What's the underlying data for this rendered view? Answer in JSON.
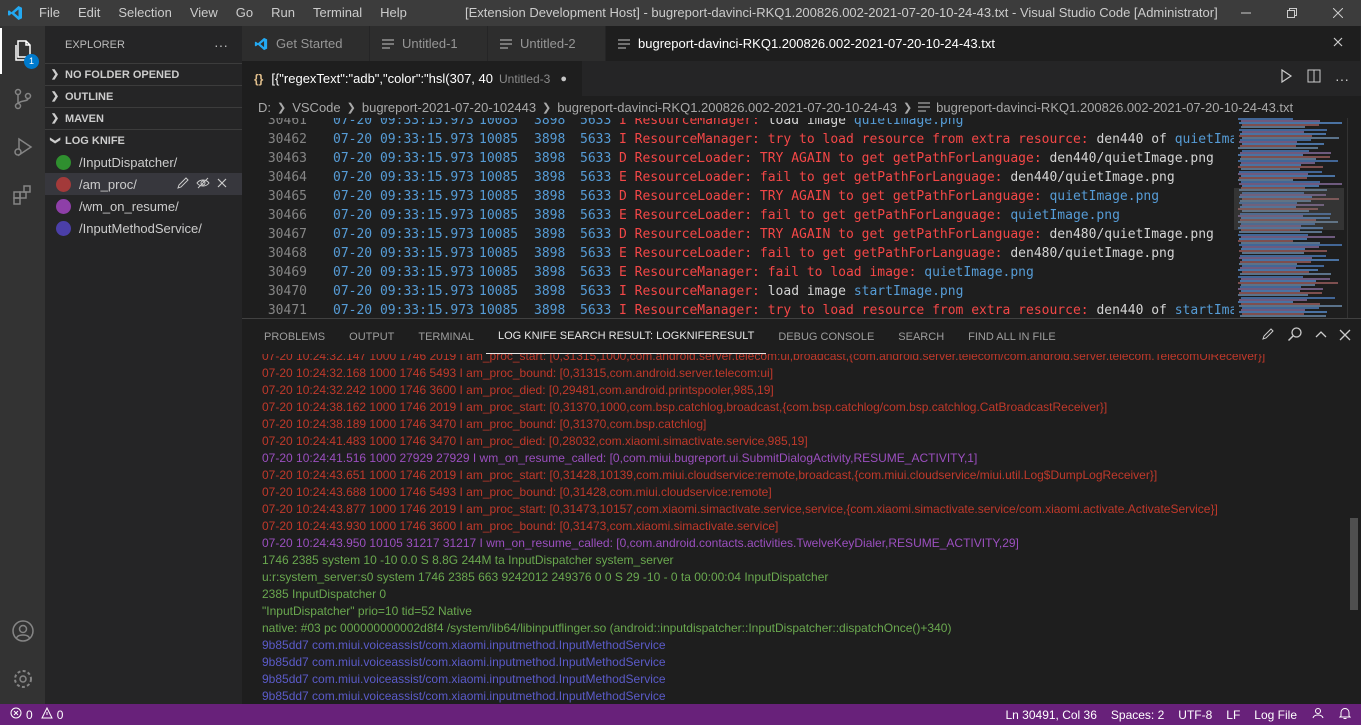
{
  "titlebar": {
    "menus": [
      "File",
      "Edit",
      "Selection",
      "View",
      "Go",
      "Run",
      "Terminal",
      "Help"
    ],
    "window_title": "[Extension Development Host] - bugreport-davinci-RKQ1.200826.002-2021-07-20-10-24-43.txt - Visual Studio Code [Administrator]"
  },
  "activitybar": {
    "explorer_badge": "1"
  },
  "sidebar": {
    "title": "EXPLORER",
    "more": "···",
    "sections": [
      "NO FOLDER OPENED",
      "OUTLINE",
      "MAVEN",
      "LOG KNIFE"
    ],
    "log_knife_items": [
      {
        "label": "/InputDispatcher/",
        "color": "#2f8f2f"
      },
      {
        "label": "/am_proc/",
        "color": "#a33a3a"
      },
      {
        "label": "/wm_on_resume/",
        "color": "#8e3fa8"
      },
      {
        "label": "/InputMethodService/",
        "color": "#4b3fa8"
      }
    ]
  },
  "tabs": [
    {
      "label": "Get Started",
      "icon": "vscode-icon"
    },
    {
      "label": "Untitled-1",
      "icon": "lines-icon"
    },
    {
      "label": "Untitled-2",
      "icon": "lines-icon"
    },
    {
      "label": "bugreport-davinci-RKQ1.200826.002-2021-07-20-10-24-43.txt",
      "icon": "lines-icon"
    }
  ],
  "tab2": {
    "icon": "{}",
    "label": "[{\"regexText\":\"adb\",\"color\":\"hsl(307, 40",
    "desc": "Untitled-3",
    "modified": "●"
  },
  "breadcrumb": [
    "D:",
    "VSCode",
    "bugreport-2021-07-20-102443",
    "bugreport-davinci-RKQ1.200826.002-2021-07-20-10-24-43",
    "bugreport-davinci-RKQ1.200826.002-2021-07-20-10-24-43.txt"
  ],
  "editor": {
    "lines": [
      {
        "num": "30461",
        "date": "07-20 09:33:15.973",
        "p1": "10085",
        "p2": "3898",
        "p3": "5633",
        "lvl": "I",
        "red": "ResourceManager:",
        "wht": "load image",
        "blu": "quietImage.png",
        "tail": ""
      },
      {
        "num": "30462",
        "date": "07-20 09:33:15.973",
        "p1": "10085",
        "p2": "3898",
        "p3": "5633",
        "lvl": "I",
        "red": "ResourceManager: try to load resource from extra resource:",
        "wht": "den440 of",
        "blu": "quietImag",
        "tail": ""
      },
      {
        "num": "30463",
        "date": "07-20 09:33:15.973",
        "p1": "10085",
        "p2": "3898",
        "p3": "5633",
        "lvl": "D",
        "red": "ResourceLoader: TRY AGAIN to get getPathForLanguage:",
        "wht": "den440/quietImage.png",
        "blu": "",
        "tail": ""
      },
      {
        "num": "30464",
        "date": "07-20 09:33:15.973",
        "p1": "10085",
        "p2": "3898",
        "p3": "5633",
        "lvl": "E",
        "red": "ResourceLoader: fail to get getPathForLanguage:",
        "wht": "den440/quietImage.png",
        "blu": "",
        "tail": ""
      },
      {
        "num": "30465",
        "date": "07-20 09:33:15.973",
        "p1": "10085",
        "p2": "3898",
        "p3": "5633",
        "lvl": "D",
        "red": "ResourceLoader: TRY AGAIN to get getPathForLanguage:",
        "wht": "",
        "blu": "quietImage.png",
        "tail": ""
      },
      {
        "num": "30466",
        "date": "07-20 09:33:15.973",
        "p1": "10085",
        "p2": "3898",
        "p3": "5633",
        "lvl": "E",
        "red": "ResourceLoader: fail to get getPathForLanguage:",
        "wht": "",
        "blu": "quietImage.png",
        "tail": ""
      },
      {
        "num": "30467",
        "date": "07-20 09:33:15.973",
        "p1": "10085",
        "p2": "3898",
        "p3": "5633",
        "lvl": "D",
        "red": "ResourceLoader: TRY AGAIN to get getPathForLanguage:",
        "wht": "den480/quietImage.png",
        "blu": "",
        "tail": ""
      },
      {
        "num": "30468",
        "date": "07-20 09:33:15.973",
        "p1": "10085",
        "p2": "3898",
        "p3": "5633",
        "lvl": "E",
        "red": "ResourceLoader: fail to get getPathForLanguage:",
        "wht": "den480/quietImage.png",
        "blu": "",
        "tail": ""
      },
      {
        "num": "30469",
        "date": "07-20 09:33:15.973",
        "p1": "10085",
        "p2": "3898",
        "p3": "5633",
        "lvl": "E",
        "red": "ResourceManager: fail to load image:",
        "wht": "",
        "blu": "quietImage.png",
        "tail": ""
      },
      {
        "num": "30470",
        "date": "07-20 09:33:15.973",
        "p1": "10085",
        "p2": "3898",
        "p3": "5633",
        "lvl": "I",
        "red": "ResourceManager:",
        "wht": "load image",
        "blu": "startImage.png",
        "tail": ""
      },
      {
        "num": "30471",
        "date": "07-20 09:33:15.973",
        "p1": "10085",
        "p2": "3898",
        "p3": "5633",
        "lvl": "I",
        "red": "ResourceManager: try to load resource from extra resource:",
        "wht": "den440 of",
        "blu": "startImag",
        "tail": ""
      }
    ]
  },
  "panel": {
    "tabs": [
      "PROBLEMS",
      "OUTPUT",
      "TERMINAL",
      "LOG KNIFE SEARCH RESULT: LOGKNIFERESULT",
      "DEBUG CONSOLE",
      "SEARCH",
      "FIND ALL IN FILE"
    ],
    "active_tab": 3,
    "lines": [
      {
        "text": "07-20 10:24:32.147 1000 1746 2019 I am_proc_start: [0,31315,1000,com.android.server.telecom:ui,broadcast,{com.android.server.telecom/com.android.server.telecom.TelecomUiReceiver}]",
        "color": "red"
      },
      {
        "text": "07-20 10:24:32.168 1000 1746 5493 I am_proc_bound: [0,31315,com.android.server.telecom:ui]",
        "color": "red"
      },
      {
        "text": "07-20 10:24:32.242 1000 1746 3600 I am_proc_died: [0,29481,com.android.printspooler,985,19]",
        "color": "red"
      },
      {
        "text": "07-20 10:24:38.162 1000 1746 2019 I am_proc_start: [0,31370,1000,com.bsp.catchlog,broadcast,{com.bsp.catchlog/com.bsp.catchlog.CatBroadcastReceiver}]",
        "color": "red"
      },
      {
        "text": "07-20 10:24:38.189 1000 1746 3470 I am_proc_bound: [0,31370,com.bsp.catchlog]",
        "color": "red"
      },
      {
        "text": "07-20 10:24:41.483 1000 1746 3470 I am_proc_died: [0,28032,com.xiaomi.simactivate.service,985,19]",
        "color": "red"
      },
      {
        "text": "07-20 10:24:41.516 1000 27929 27929 I wm_on_resume_called: [0,com.miui.bugreport.ui.SubmitDialogActivity,RESUME_ACTIVITY,1]",
        "color": "purple"
      },
      {
        "text": "07-20 10:24:43.651 1000 1746 2019 I am_proc_start: [0,31428,10139,com.miui.cloudservice:remote,broadcast,{com.miui.cloudservice/miui.util.Log$DumpLogReceiver}]",
        "color": "red"
      },
      {
        "text": "07-20 10:24:43.688 1000 1746 5493 I am_proc_bound: [0,31428,com.miui.cloudservice:remote]",
        "color": "red"
      },
      {
        "text": "07-20 10:24:43.877 1000 1746 2019 I am_proc_start: [0,31473,10157,com.xiaomi.simactivate.service,service,{com.xiaomi.simactivate.service/com.xiaomi.activate.ActivateService}]",
        "color": "red"
      },
      {
        "text": "07-20 10:24:43.930 1000 1746 3600 I am_proc_bound: [0,31473,com.xiaomi.simactivate.service]",
        "color": "red"
      },
      {
        "text": "07-20 10:24:43.950 10105 31217 31217 I wm_on_resume_called: [0,com.android.contacts.activities.TwelveKeyDialer,RESUME_ACTIVITY,29]",
        "color": "purple"
      },
      {
        "text": "1746 2385 system 10 -10 0.0 S 8.8G 244M ta InputDispatcher system_server",
        "color": "green"
      },
      {
        "text": "u:r:system_server:s0 system 1746 2385 663 9242012 249376 0 0 S 29 -10 - 0 ta 00:00:04 InputDispatcher",
        "color": "green"
      },
      {
        "text": "2385 InputDispatcher 0",
        "color": "green"
      },
      {
        "text": "\"InputDispatcher\" prio=10 tid=52 Native",
        "color": "green"
      },
      {
        "text": "native: #03 pc 000000000002d8f4 /system/lib64/libinputflinger.so (android::inputdispatcher::InputDispatcher::dispatchOnce()+340)",
        "color": "green"
      },
      {
        "text": "9b85dd7 com.miui.voiceassist/com.xiaomi.inputmethod.InputMethodService",
        "color": "blue"
      },
      {
        "text": "9b85dd7 com.miui.voiceassist/com.xiaomi.inputmethod.InputMethodService",
        "color": "blue"
      },
      {
        "text": "9b85dd7 com.miui.voiceassist/com.xiaomi.inputmethod.InputMethodService",
        "color": "blue"
      },
      {
        "text": "9b85dd7 com.miui.voiceassist/com.xiaomi.inputmethod.InputMethodService",
        "color": "blue"
      }
    ]
  },
  "statusbar": {
    "errors": "0",
    "warnings": "0",
    "position": "Ln 30491, Col 36",
    "spaces": "Spaces: 2",
    "encoding": "UTF-8",
    "eol": "LF",
    "language": "Log File"
  },
  "colors": {
    "accent": "#007acc",
    "statusbar": "#68217a"
  }
}
